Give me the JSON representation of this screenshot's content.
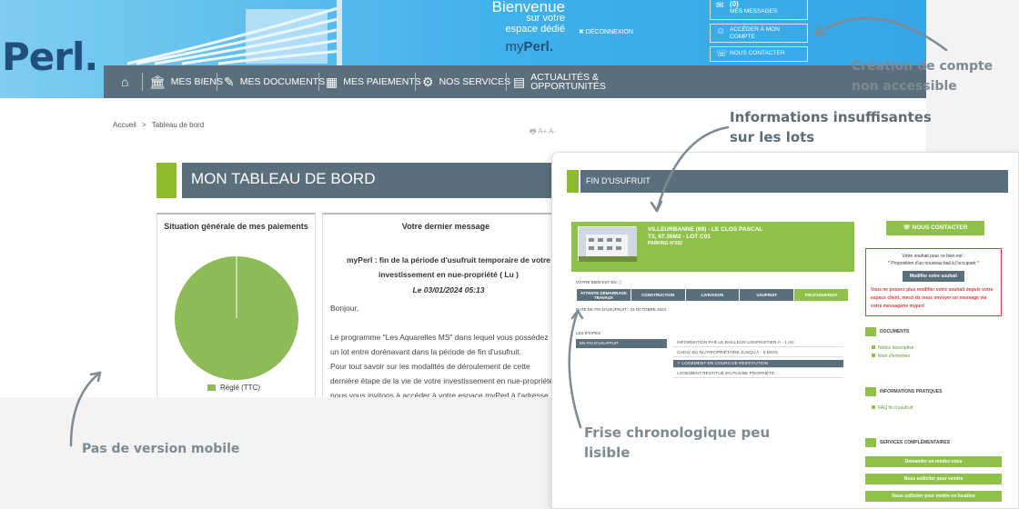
{
  "header": {
    "logo": "Perl.",
    "welcome_line1": "Bienvenue",
    "welcome_line2": "sur votre",
    "welcome_line3": "espace dédié",
    "brand_prefix": "my",
    "brand_suffix": "Perl.",
    "logout": "✖ DÉCONNEXION",
    "top_buttons": [
      {
        "icon": "envelope-icon",
        "line1": "(0)",
        "line2": "MES MESSAGES"
      },
      {
        "icon": "user-icon",
        "line1": "ACCÉDER À MON",
        "line2": "COMPTE"
      },
      {
        "icon": "chat-icon",
        "line1": "NOUS CONTACTER",
        "line2": ""
      }
    ]
  },
  "nav": {
    "items": [
      {
        "label": "MES BIENS",
        "icon": "bank-icon"
      },
      {
        "label": "MES DOCUMENTS",
        "icon": "document-icon"
      },
      {
        "label": "MES PAIEMENTS",
        "icon": "calendar-icon"
      },
      {
        "label": "NOS SERVICES",
        "icon": "gears-icon"
      },
      {
        "label": "ACTUALITÉS &",
        "label2": "OPPORTUNITÉS",
        "icon": "news-icon"
      }
    ]
  },
  "breadcrumb": {
    "home": "Accueil",
    "sep": ">",
    "current": "Tableau de bord"
  },
  "tools": "🖶  A+  A-",
  "dashboard": {
    "title": "MON TABLEAU DE BORD"
  },
  "payments": {
    "title": "Situation générale de mes paiements",
    "legend": "Réglé (TTC)",
    "color": "#8dbb57"
  },
  "message": {
    "title": "Votre dernier message",
    "subject_line1": "myPerl : fin de la période d'usufruit temporaire de votre",
    "subject_line2": "investissement en nue-propriété ( Lu )",
    "date": "Le 03/01/2024 05:13",
    "body": [
      "Bonjour,",
      "",
      "Le programme \"Les Aquarelles MS\" dans lequel vous possédez",
      "un lot entre dorénavant dans la période de fin d'usufruit.",
      "Pour tout savoir sur les modalités de déroulement de cette",
      "dernière étape de la vie de votre investissement en nue-propriété,",
      "nous vous invitons à accéder à votre espace myPerl à l'adresse"
    ]
  },
  "detail": {
    "title": "FIN D'USUFRUIT",
    "lot": {
      "city": "VILLEURBANNE (69) - LE CLOS PASCAL",
      "type": "T3, 67.36M2 - LOT C01",
      "parking": "PARKING N°292"
    },
    "contact": "NOUS CONTACTER",
    "wish": {
      "line1": "Votre souhait pour ce bien est :",
      "line2": "* Proposition d'un nouveau bail à l'occupant *",
      "button": "Modifier votre souhait",
      "warning": "Vous ne pouvez plus modifier votre souhait depuis votre espace client, merci de nous envoyer un message via votre messagerie myperl"
    },
    "stage_label": "VOTRE BIEN EST EN",
    "stages": [
      "ATTENTE DÉMARRAGE TRAVAUX",
      "CONSTRUCTION",
      "LIVRAISON",
      "USUFRUIT",
      "FIN D'USUFRUIT"
    ],
    "stage_date": "DATE DE FIN D'USUFRUIT : 03 OCTOBRE 2024",
    "steps_label": "LES ÉTAPES",
    "step_head": "EN FIN D'USUFRUIT",
    "substeps": [
      "INFORMATION PAR LE BAILLEUR USUFRUITIER À - 1 AN",
      "CHOIX DU NU-PROPRIÉTAIRE JUSQU'À - 6 MOIS",
      "LOGEMENT EN COURS DE RESTITUTION",
      "LOGEMENT RESTITUÉ EN PLEINE PROPRIÉTÉ"
    ],
    "documents": {
      "title": "DOCUMENTS",
      "links": [
        "Notice descriptive",
        "Note d'entretien"
      ]
    },
    "infos": {
      "title": "INFORMATIONS PRATIQUES",
      "links": [
        "FAQ fin d'usufruit"
      ]
    },
    "services": {
      "title": "SERVICES COMPLÉMENTAIRES",
      "buttons": [
        "Demander un rendez-vous",
        "Nous solliciter pour vendre",
        "Nous solliciter pour mettre en location"
      ]
    }
  },
  "annotations": {
    "account": [
      "Création de compte",
      "non accessible"
    ],
    "lots": [
      "Informations insuffisantes",
      "sur les lots"
    ],
    "timeline": [
      "Frise chronologique peu",
      "lisible"
    ],
    "mobile": "Pas de version mobile"
  }
}
